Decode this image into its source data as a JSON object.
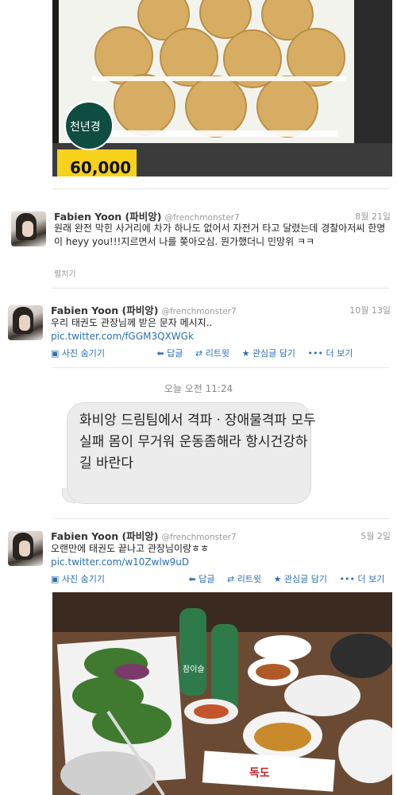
{
  "top_photo": {
    "price_tag": "60,000",
    "brand_badge": "천년경"
  },
  "tweets": [
    {
      "name": "Fabien Yoon (파비앙)",
      "handle": "@frenchmonster7",
      "date": "8월 21일",
      "text": "원래 완전 막힌 사거리에 차가 하나도 없어서 자전거 타고 달렸는데 경찰아저씨 한명이 heyy you!!!지르면서 나를 쫒아오심. 뭔가했더니 민망위 ㅋㅋ",
      "expand": "펼치기"
    },
    {
      "name": "Fabien Yoon (파비앙)",
      "handle": "@frenchmonster7",
      "date": "10월 13일",
      "text": "우리 태권도 관장님께 받은 문자 메시지..",
      "link": "pic.twitter.com/fGGM3QXWGk",
      "actions": [
        "사진 숨기기",
        "답글",
        "리트윗",
        "관심글 담기",
        "더 보기"
      ]
    },
    {
      "name": "Fabien Yoon (파비앙)",
      "handle": "@frenchmonster7",
      "date": "5월 2일",
      "text": "오랜만에 태권도 끝나고 관장님이랑ㅎㅎ",
      "link": "pic.twitter.com/w10Zwlw9uD",
      "actions": [
        "사진 숨기기",
        "답글",
        "리트윗",
        "관심글 담기",
        "더 보기"
      ]
    }
  ],
  "message": {
    "time": "오늘 오전 11:24",
    "text": "화비앙 드림팀에서 격파ㆍ장애물격파 모두실패 몸이 무거워 운동좀해라  항시건강하길 바란다"
  },
  "bottom_photo": {
    "bottle_label": "참이슬",
    "package_label": "독도"
  }
}
